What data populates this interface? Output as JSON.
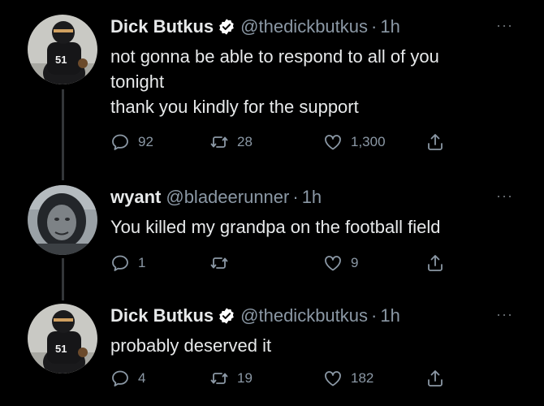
{
  "tweets": [
    {
      "name": "Dick Butkus",
      "handle": "@thedickbutkus",
      "separator": "·",
      "time": "1h",
      "verified": true,
      "text": "not gonna be able to respond to all of you\ntonight\nthank you kindly for the support",
      "replies": "92",
      "retweets": "28",
      "likes": "1,300",
      "avatar_jersey": "51"
    },
    {
      "name": "wyant",
      "handle": "@bladeerunner",
      "separator": "·",
      "time": "1h",
      "verified": false,
      "text": "You killed my grandpa on the football field",
      "replies": "1",
      "retweets": "",
      "likes": "9"
    },
    {
      "name": "Dick Butkus",
      "handle": "@thedickbutkus",
      "separator": "·",
      "time": "1h",
      "verified": true,
      "text": "probably deserved it",
      "replies": "4",
      "retweets": "19",
      "likes": "182",
      "avatar_jersey": "51"
    }
  ],
  "more_label": "···",
  "colors": {
    "background": "#000000",
    "primary_text": "#e7e9ea",
    "secondary_text": "#8b98a5",
    "verified_badge": "#ffffff",
    "thread_line": "#333639"
  },
  "icons": {
    "reply": "reply-icon",
    "retweet": "retweet-icon",
    "like": "heart-icon",
    "share": "share-icon",
    "verified": "verified-badge-icon",
    "more": "more-options-icon"
  }
}
